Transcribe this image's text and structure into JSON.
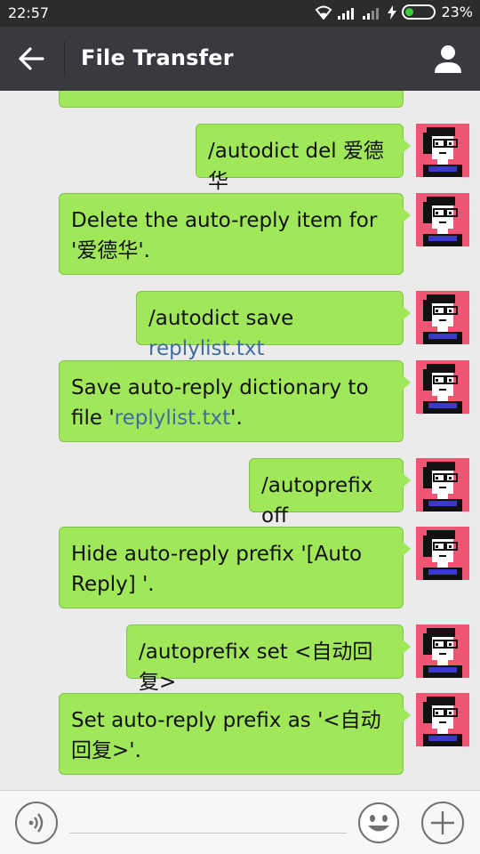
{
  "status_bar": {
    "time": "22:57",
    "battery_percent": "23%"
  },
  "header": {
    "title": "File Transfer"
  },
  "messages": [
    {
      "text": ""
    },
    {
      "text": "/autodict del 爱德华"
    },
    {
      "text": "Delete the auto-reply item for '爱德华'."
    },
    {
      "text": "/autodict save ",
      "link": "replylist.txt"
    },
    {
      "pre": "Save auto-reply dictionary to file '",
      "link": "replylist.txt",
      "post": "'."
    },
    {
      "text": "/autoprefix off"
    },
    {
      "text": "Hide auto-reply prefix '[Auto Reply] '."
    },
    {
      "text": "/autoprefix set <自动回复>"
    },
    {
      "text": "Set auto-reply prefix as '<自动回复>'."
    }
  ],
  "colors": {
    "bubble": "#a0e75a",
    "header": "#393a3f",
    "link": "#3f6e9c"
  }
}
